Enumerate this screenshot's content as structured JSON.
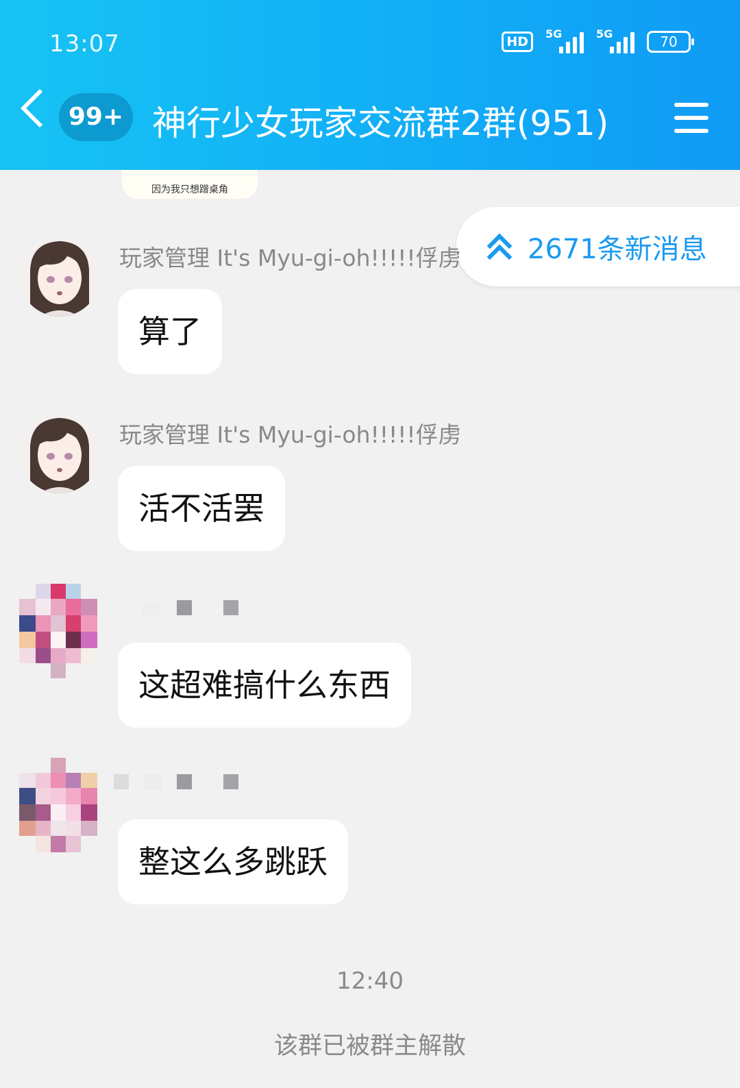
{
  "status_bar": {
    "time": "13:07",
    "hd_label": "HD",
    "signal1_label": "5G",
    "signal2_label": "5G",
    "battery": "70"
  },
  "header": {
    "unread_count": "99+",
    "group_title": "神行少女玩家交流群2群(951)"
  },
  "image_fragment_caption": "因为我只想蹭桌角",
  "new_messages_pill": "2671条新消息",
  "messages": [
    {
      "sender": "玩家管理 It's Myu-gi-oh!!!!!俘虏",
      "text": "算了"
    },
    {
      "sender": "玩家管理 It's Myu-gi-oh!!!!!俘虏",
      "text": "活不活罢"
    },
    {
      "sender": "",
      "text": "这超难搞什么东西"
    },
    {
      "sender": "",
      "text": "整这么多跳跃"
    }
  ],
  "time_separator": "12:40",
  "system_note": "该群已被群主解散",
  "colors": {
    "header_start": "#16c3f4",
    "header_end": "#0f9bf5",
    "accent": "#1a9af0",
    "background": "#f1f1f1"
  }
}
